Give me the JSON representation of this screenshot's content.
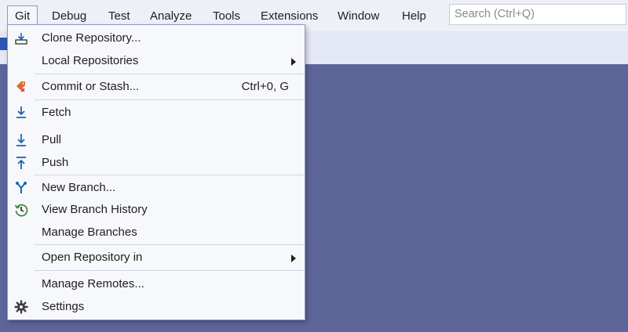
{
  "menubar": {
    "items": [
      {
        "label": "Git"
      },
      {
        "label": "Debug"
      },
      {
        "label": "Test"
      },
      {
        "label": "Analyze"
      },
      {
        "label": "Tools"
      },
      {
        "label": "Extensions"
      },
      {
        "label": "Window"
      },
      {
        "label": "Help"
      }
    ],
    "search_placeholder": "Search (Ctrl+Q)"
  },
  "git_menu": {
    "items": [
      {
        "label": "Clone Repository...",
        "icon": "clone-icon"
      },
      {
        "label": "Local Repositories",
        "submenu": true
      },
      {
        "label": "Commit or Stash...",
        "shortcut": "Ctrl+0, G",
        "icon": "commit-icon"
      },
      {
        "label": "Fetch",
        "icon": "fetch-icon"
      },
      {
        "label": "Pull",
        "icon": "pull-icon"
      },
      {
        "label": "Push",
        "icon": "push-icon"
      },
      {
        "label": "New Branch...",
        "icon": "branch-icon"
      },
      {
        "label": "View Branch History",
        "icon": "history-icon"
      },
      {
        "label": "Manage Branches"
      },
      {
        "label": "Open Repository in",
        "submenu": true
      },
      {
        "label": "Manage Remotes..."
      },
      {
        "label": "Settings",
        "icon": "gear-icon"
      }
    ]
  },
  "colors": {
    "background": "#5c6699",
    "menubar": "#eef0f8",
    "dropdown": "#f7f8fc",
    "icon_blue": "#1c64b4",
    "icon_green": "#3a8a3a",
    "icon_orange": "#e06b2a"
  }
}
